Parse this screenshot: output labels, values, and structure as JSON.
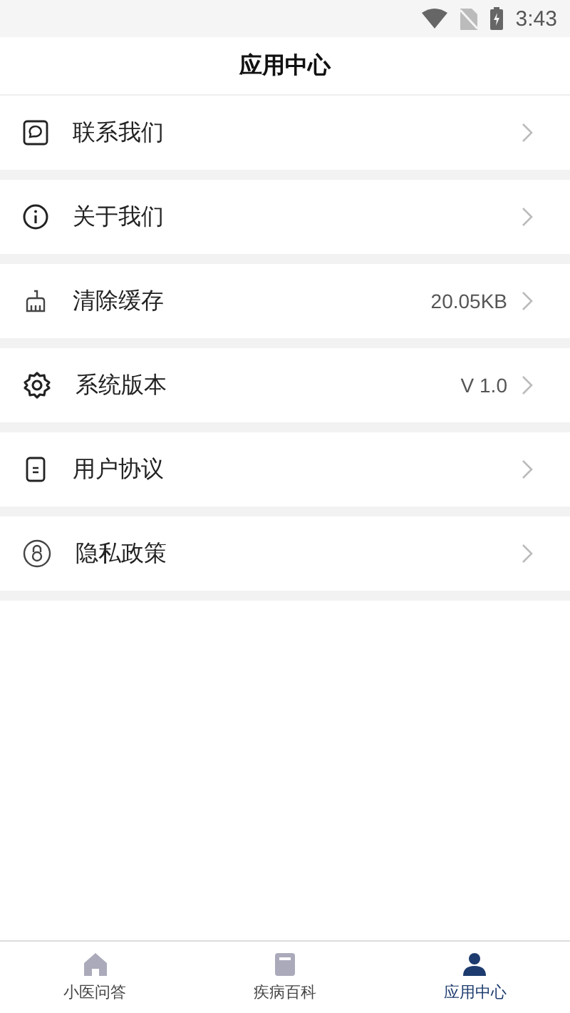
{
  "status_bar": {
    "time": "3:43"
  },
  "header": {
    "title": "应用中心"
  },
  "menu": [
    {
      "label": "联系我们"
    },
    {
      "label": "关于我们"
    },
    {
      "label": "清除缓存",
      "value": "20.05KB"
    },
    {
      "label": "系统版本",
      "value": "V 1.0"
    },
    {
      "label": "用户协议"
    },
    {
      "label": "隐私政策"
    }
  ],
  "bottom_nav": [
    {
      "label": "小医问答",
      "selected": false
    },
    {
      "label": "疾病百科",
      "selected": false
    },
    {
      "label": "应用中心",
      "selected": true
    }
  ]
}
